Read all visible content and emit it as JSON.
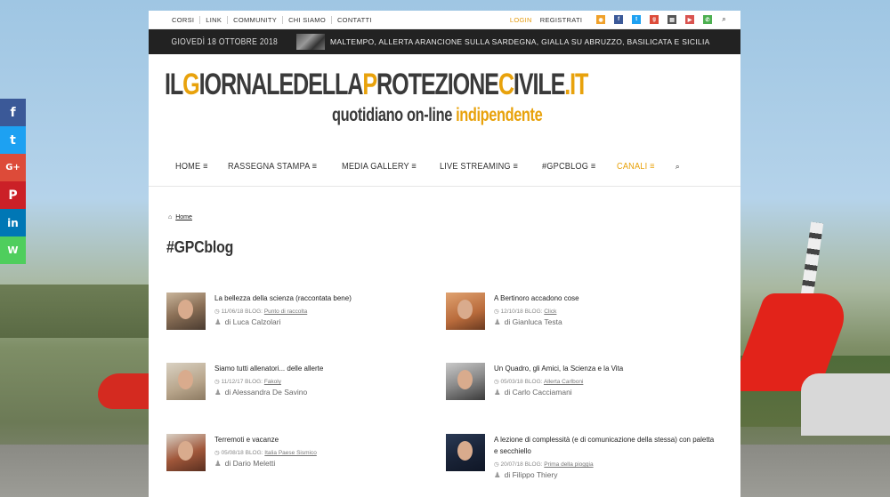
{
  "share": [
    {
      "icon": "f",
      "color": "#3b5998",
      "name": "facebook-share"
    },
    {
      "icon": "t",
      "color": "#1da1f2",
      "name": "twitter-share"
    },
    {
      "icon": "G+",
      "color": "#dd4b39",
      "name": "googleplus-share"
    },
    {
      "icon": "P",
      "color": "#cb2027",
      "name": "pinterest-share"
    },
    {
      "icon": "in",
      "color": "#0077b5",
      "name": "linkedin-share"
    },
    {
      "icon": "W",
      "color": "#4fce5d",
      "name": "whatsapp-share"
    }
  ],
  "topbar": {
    "nav": [
      "CORSI",
      "LINK",
      "COMMUNITY",
      "CHI SIAMO",
      "CONTATTI"
    ],
    "login": "LOGIN",
    "register": "REGISTRATI"
  },
  "topbar_social": [
    {
      "icon": "rss",
      "color": "#f0a12a"
    },
    {
      "icon": "f",
      "color": "#3b5998"
    },
    {
      "icon": "t",
      "color": "#1da1f2"
    },
    {
      "icon": "g",
      "color": "#dd4b39"
    },
    {
      "icon": "print",
      "color": "#555555"
    },
    {
      "icon": "yt",
      "color": "#d9534f"
    },
    {
      "icon": "wa",
      "color": "#4caf50"
    }
  ],
  "ticker": {
    "date": "GIOVEDÌ 18 OTTOBRE 2018",
    "text": "MALTEMPO, ALLERTA ARANCIONE SULLA SARDEGNA, GIALLA SU ABRUZZO, BASILICATA E SICILIA"
  },
  "logo": {
    "il": "IL",
    "g": "G",
    "iornaledella": "IORNALEDELLA",
    "p": "P",
    "rotezione": "ROTEZIONE",
    "c": "C",
    "ivile": "IVILE",
    "dotit": ".IT",
    "tag1": "quotidiano on-line ",
    "tag2": "indipendente"
  },
  "mainnav": [
    "HOME ≡",
    "RASSEGNA STAMPA ≡",
    "MEDIA GALLERY ≡",
    "LIVE STREAMING ≡",
    "#GPCBLOG ≡",
    "CANALI ≡"
  ],
  "breadcrumb": {
    "home": "Home"
  },
  "page_title": "#GPCblog",
  "posts": [
    {
      "title": "La bellezza della scienza (raccontata bene)",
      "date": "11/06/18",
      "blog": "BLOG:",
      "blogname": "Punto di raccolta",
      "author": "di Luca Calzolari"
    },
    {
      "title": "A Bertinoro accadono cose",
      "date": "12/10/18",
      "blog": "BLOG:",
      "blogname": "Click",
      "author": "di Gianluca Testa"
    },
    {
      "title": "Siamo tutti allenatori... delle allerte",
      "date": "11/12/17",
      "blog": "BLOG:",
      "blogname": "Fakoly",
      "author": "di Alessandra De Savino"
    },
    {
      "title": "Un Quadro, gli Amici, la Scienza e la Vita",
      "date": "05/03/18",
      "blog": "BLOG:",
      "blogname": "Allerta Carlboni",
      "author": "di Carlo Cacciamani"
    },
    {
      "title": "Terremoti e vacanze",
      "date": "05/08/18",
      "blog": "BLOG:",
      "blogname": "Italia Paese Sismico",
      "author": "di Dario Meletti"
    },
    {
      "title": "A lezione di complessità (e di comunicazione della stessa) con paletta e secchiello",
      "date": "20/07/18",
      "blog": "BLOG:",
      "blogname": "Prima della pioggia",
      "author": "di Filippo Thiery"
    }
  ]
}
